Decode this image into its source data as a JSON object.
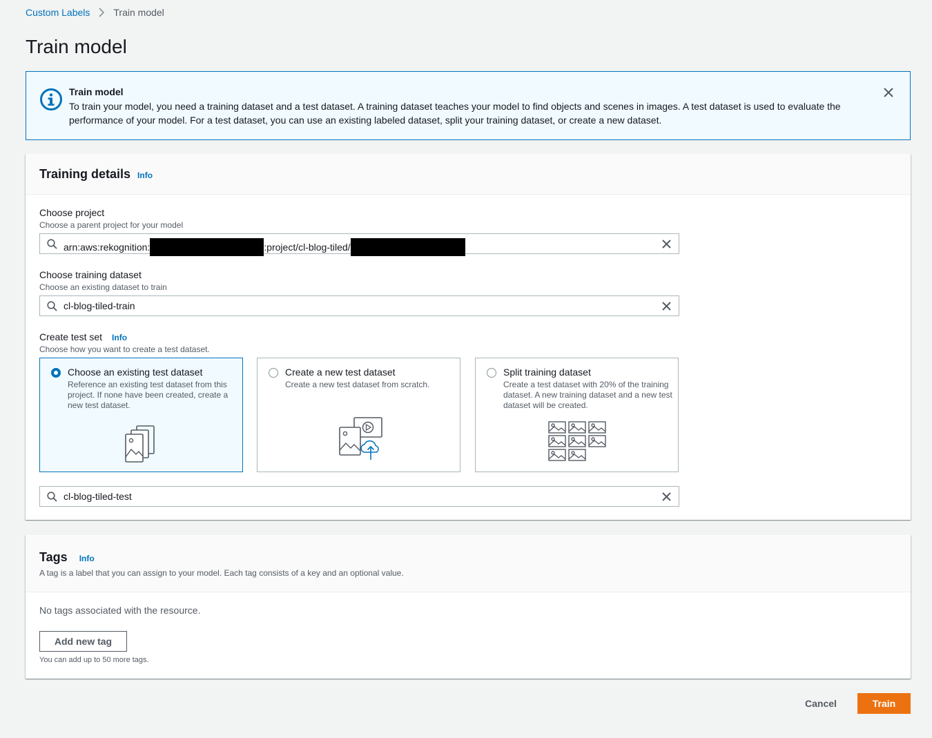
{
  "breadcrumb": {
    "items": [
      "Custom Labels",
      "Train model"
    ]
  },
  "page_title": "Train model",
  "flash": {
    "title": "Train model",
    "body": "To train your model, you need a training dataset and a test dataset. A training dataset teaches your model to find objects and scenes in images. A test dataset is used to evaluate the performance of your model. For a test dataset, you can use an existing labeled dataset, split your training dataset, or create a new dataset.",
    "icon": "info-icon"
  },
  "training_details": {
    "title": "Training details",
    "info": "Info",
    "project": {
      "label": "Choose project",
      "description": "Choose a parent project for your model",
      "value_prefix": "arn:aws:rekognition:",
      "value_middle": ":project/cl-blog-tiled/"
    },
    "training_dataset": {
      "label": "Choose training dataset",
      "description": "Choose an existing dataset to train",
      "value": "cl-blog-tiled-train"
    },
    "test_set": {
      "label": "Create test set",
      "info": "Info",
      "description": "Choose how you want to create a test dataset.",
      "options": [
        {
          "label": "Choose an existing test dataset",
          "description": "Reference an existing test dataset from this project. If none have been created, create a new test dataset.",
          "selected": true
        },
        {
          "label": "Create a new test dataset",
          "description": "Create a new test dataset from scratch.",
          "selected": false
        },
        {
          "label": "Split training dataset",
          "description": "Create a test dataset with 20% of the training dataset. A new training dataset and a new test dataset will be created.",
          "selected": false
        }
      ],
      "value": "cl-blog-tiled-test"
    }
  },
  "tags": {
    "title": "Tags",
    "info": "Info",
    "description": "A tag is a label that you can assign to your model. Each tag consists of a key and an optional value.",
    "empty_text": "No tags associated with the resource.",
    "add_button": "Add new tag",
    "hint": "You can add up to 50 more tags."
  },
  "footer": {
    "cancel": "Cancel",
    "train": "Train"
  },
  "colors": {
    "link": "#0073bb",
    "primary": "#ec7211",
    "info_bg": "#f1faff"
  }
}
